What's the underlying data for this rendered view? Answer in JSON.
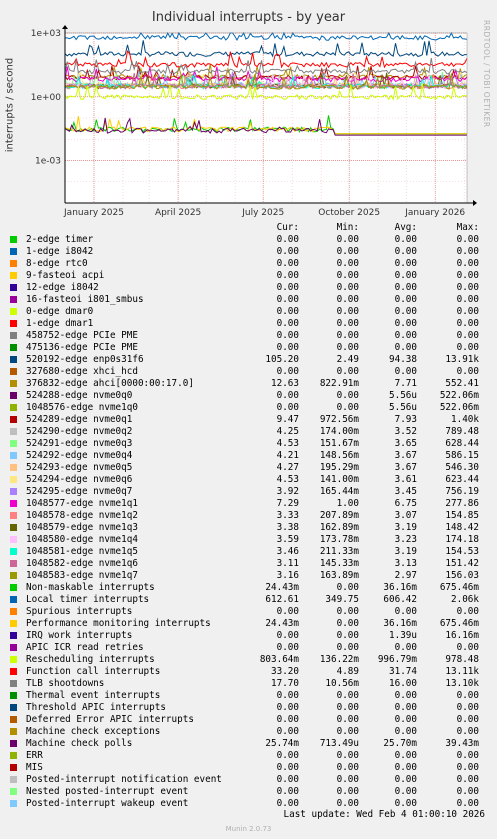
{
  "side_text": "RRDTOOL / TOBI OETIKER",
  "last_update": "Last update: Wed Feb  4 01:00:10 2026",
  "footer": "Munin 2.0.73",
  "legend_header": {
    "cur": "Cur:",
    "min": "Min:",
    "avg": "Avg:",
    "max": "Max:"
  },
  "chart_data": {
    "type": "line",
    "title": "Individual interrupts - by year",
    "ylabel": "interrupts / second",
    "yscale": "log",
    "ylim": [
      1e-05,
      1000
    ],
    "y_ticks": [
      "1e+03",
      "1e+00",
      "1e-03"
    ],
    "y_tick_values": [
      1000,
      1,
      0.001
    ],
    "x_ticks": [
      "January 2025",
      "April 2025",
      "July 2025",
      "October 2025",
      "January 2026"
    ],
    "x_tick_dates": [
      "2025-01-01",
      "2025-04-01",
      "2025-07-01",
      "2025-10-01",
      "2026-01-01"
    ],
    "x_range": [
      "2024-12-01",
      "2026-02-04"
    ],
    "grid": true,
    "series": [
      {
        "name": "2-edge timer",
        "color": "#00cc00",
        "cur": "0.00",
        "min": "0.00",
        "avg": "0.00",
        "max": "0.00"
      },
      {
        "name": "1-edge i8042",
        "color": "#0066b3",
        "cur": "0.00",
        "min": "0.00",
        "avg": "0.00",
        "max": "0.00"
      },
      {
        "name": "8-edge rtc0",
        "color": "#ff8000",
        "cur": "0.00",
        "min": "0.00",
        "avg": "0.00",
        "max": "0.00"
      },
      {
        "name": "9-fasteoi acpi",
        "color": "#ffcc00",
        "cur": "0.00",
        "min": "0.00",
        "avg": "0.00",
        "max": "0.00"
      },
      {
        "name": "12-edge i8042",
        "color": "#330099",
        "cur": "0.00",
        "min": "0.00",
        "avg": "0.00",
        "max": "0.00"
      },
      {
        "name": "16-fasteoi i801_smbus",
        "color": "#990099",
        "cur": "0.00",
        "min": "0.00",
        "avg": "0.00",
        "max": "0.00"
      },
      {
        "name": "0-edge dmar0",
        "color": "#ccff00",
        "cur": "0.00",
        "min": "0.00",
        "avg": "0.00",
        "max": "0.00"
      },
      {
        "name": "1-edge dmar1",
        "color": "#ff0000",
        "cur": "0.00",
        "min": "0.00",
        "avg": "0.00",
        "max": "0.00"
      },
      {
        "name": "458752-edge PCIe PME",
        "color": "#808080",
        "cur": "0.00",
        "min": "0.00",
        "avg": "0.00",
        "max": "0.00"
      },
      {
        "name": "475136-edge PCIe PME",
        "color": "#008f00",
        "cur": "0.00",
        "min": "0.00",
        "avg": "0.00",
        "max": "0.00"
      },
      {
        "name": "520192-edge enp0s31f6",
        "color": "#00487d",
        "cur": "105.20",
        "min": "2.49",
        "avg": "94.38",
        "max": "13.91k",
        "level": 105
      },
      {
        "name": "327680-edge xhci_hcd",
        "color": "#b35a00",
        "cur": "0.00",
        "min": "0.00",
        "avg": "0.00",
        "max": "0.00"
      },
      {
        "name": "376832-edge ahci[0000:00:17.0]",
        "color": "#b38f00",
        "cur": "12.63",
        "min": "822.91m",
        "avg": "7.71",
        "max": "552.41",
        "level": 9
      },
      {
        "name": "524288-edge nvme0q0",
        "color": "#6b006b",
        "cur": "0.00",
        "min": "0.00",
        "avg": "5.56u",
        "max": "522.06m"
      },
      {
        "name": "1048576-edge nvme1q0",
        "color": "#8fb300",
        "cur": "0.00",
        "min": "0.00",
        "avg": "5.56u",
        "max": "522.06m"
      },
      {
        "name": "524289-edge nvme0q1",
        "color": "#b30000",
        "cur": "9.47",
        "min": "972.56m",
        "avg": "7.93",
        "max": "1.40k",
        "level": 8
      },
      {
        "name": "524290-edge nvme0q2",
        "color": "#bebebe",
        "cur": "4.25",
        "min": "174.00m",
        "avg": "3.52",
        "max": "789.48",
        "level": 3.5
      },
      {
        "name": "524291-edge nvme0q3",
        "color": "#80ff80",
        "cur": "4.53",
        "min": "151.67m",
        "avg": "3.65",
        "max": "628.44",
        "level": 3.6
      },
      {
        "name": "524292-edge nvme0q4",
        "color": "#80c9ff",
        "cur": "4.21",
        "min": "148.56m",
        "avg": "3.67",
        "max": "586.15",
        "level": 3.7
      },
      {
        "name": "524293-edge nvme0q5",
        "color": "#ffc080",
        "cur": "4.27",
        "min": "195.29m",
        "avg": "3.67",
        "max": "546.30",
        "level": 3.7
      },
      {
        "name": "524294-edge nvme0q6",
        "color": "#ffe680",
        "cur": "4.53",
        "min": "141.00m",
        "avg": "3.61",
        "max": "623.44",
        "level": 3.6
      },
      {
        "name": "524295-edge nvme0q7",
        "color": "#aa80ff",
        "cur": "3.92",
        "min": "165.44m",
        "avg": "3.45",
        "max": "756.19",
        "level": 3.4
      },
      {
        "name": "1048577-edge nvme1q1",
        "color": "#ee00cc",
        "cur": "7.29",
        "min": "1.00",
        "avg": "6.75",
        "max": "277.86",
        "level": 6.8
      },
      {
        "name": "1048578-edge nvme1q2",
        "color": "#ff8080",
        "cur": "3.33",
        "min": "207.89m",
        "avg": "3.07",
        "max": "154.85",
        "level": 3.1
      },
      {
        "name": "1048579-edge nvme1q3",
        "color": "#666600",
        "cur": "3.38",
        "min": "162.89m",
        "avg": "3.19",
        "max": "148.42",
        "level": 3.2
      },
      {
        "name": "1048580-edge nvme1q4",
        "color": "#ffbfff",
        "cur": "3.59",
        "min": "173.78m",
        "avg": "3.23",
        "max": "174.18",
        "level": 3.2
      },
      {
        "name": "1048581-edge nvme1q5",
        "color": "#00ffcc",
        "cur": "3.46",
        "min": "211.33m",
        "avg": "3.19",
        "max": "154.53",
        "level": 3.2
      },
      {
        "name": "1048582-edge nvme1q6",
        "color": "#cc6699",
        "cur": "3.11",
        "min": "145.33m",
        "avg": "3.13",
        "max": "151.42",
        "level": 3.1
      },
      {
        "name": "1048583-edge nvme1q7",
        "color": "#999900",
        "cur": "3.16",
        "min": "163.89m",
        "avg": "2.97",
        "max": "156.03",
        "level": 3.0
      },
      {
        "name": "Non-maskable interrupts",
        "color": "#00cc00",
        "cur": "24.43m",
        "min": "0.00",
        "avg": "36.16m",
        "max": "675.46m",
        "level": 0.03
      },
      {
        "name": "Local timer interrupts",
        "color": "#0066b3",
        "cur": "612.61",
        "min": "349.75",
        "avg": "606.42",
        "max": "2.06k",
        "level": 610
      },
      {
        "name": "Spurious interrupts",
        "color": "#ff8000",
        "cur": "0.00",
        "min": "0.00",
        "avg": "0.00",
        "max": "0.00"
      },
      {
        "name": "Performance monitoring interrupts",
        "color": "#ffcc00",
        "cur": "24.43m",
        "min": "0.00",
        "avg": "36.16m",
        "max": "675.46m",
        "level": 0.03
      },
      {
        "name": "IRQ work interrupts",
        "color": "#330099",
        "cur": "0.00",
        "min": "0.00",
        "avg": "1.39u",
        "max": "16.16m"
      },
      {
        "name": "APIC ICR read retries",
        "color": "#990099",
        "cur": "0.00",
        "min": "0.00",
        "avg": "0.00",
        "max": "0.00"
      },
      {
        "name": "Rescheduling interrupts",
        "color": "#ccff00",
        "cur": "803.64m",
        "min": "136.22m",
        "avg": "996.79m",
        "max": "978.48",
        "level": 1
      },
      {
        "name": "Function call interrupts",
        "color": "#ff0000",
        "cur": "33.20",
        "min": "4.89",
        "avg": "31.74",
        "max": "13.11k",
        "level": 32
      },
      {
        "name": "TLB shootdowns",
        "color": "#808080",
        "cur": "17.70",
        "min": "10.56m",
        "avg": "16.00",
        "max": "13.10k",
        "level": 16
      },
      {
        "name": "Thermal event interrupts",
        "color": "#008f00",
        "cur": "0.00",
        "min": "0.00",
        "avg": "0.00",
        "max": "0.00"
      },
      {
        "name": "Threshold APIC interrupts",
        "color": "#00487d",
        "cur": "0.00",
        "min": "0.00",
        "avg": "0.00",
        "max": "0.00"
      },
      {
        "name": "Deferred Error APIC interrupts",
        "color": "#b35a00",
        "cur": "0.00",
        "min": "0.00",
        "avg": "0.00",
        "max": "0.00"
      },
      {
        "name": "Machine check exceptions",
        "color": "#b38f00",
        "cur": "0.00",
        "min": "0.00",
        "avg": "0.00",
        "max": "0.00"
      },
      {
        "name": "Machine check polls",
        "color": "#6b006b",
        "cur": "25.74m",
        "min": "713.49u",
        "avg": "25.70m",
        "max": "39.43m",
        "level": 0.026
      },
      {
        "name": "ERR",
        "color": "#8fb300",
        "cur": "0.00",
        "min": "0.00",
        "avg": "0.00",
        "max": "0.00"
      },
      {
        "name": "MIS",
        "color": "#b30000",
        "cur": "0.00",
        "min": "0.00",
        "avg": "0.00",
        "max": "0.00"
      },
      {
        "name": "Posted-interrupt notification event",
        "color": "#bebebe",
        "cur": "0.00",
        "min": "0.00",
        "avg": "0.00",
        "max": "0.00"
      },
      {
        "name": "Nested posted-interrupt event",
        "color": "#80ff80",
        "cur": "0.00",
        "min": "0.00",
        "avg": "0.00",
        "max": "0.00"
      },
      {
        "name": "Posted-interrupt wakeup event",
        "color": "#80c9ff",
        "cur": "0.00",
        "min": "0.00",
        "avg": "0.00",
        "max": "0.00"
      }
    ]
  }
}
